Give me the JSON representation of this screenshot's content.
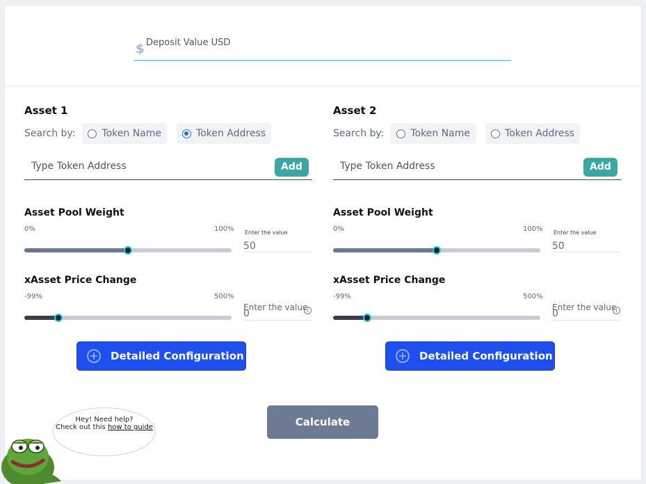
{
  "deposit": {
    "currency_symbol": "$",
    "placeholder": "Deposit Value USD"
  },
  "assets": [
    {
      "title": "Asset 1",
      "search_by_label": "Search by:",
      "options": [
        {
          "label": "Token Name",
          "checked": false
        },
        {
          "label": "Token Address",
          "checked": true
        }
      ],
      "token_placeholder": "Type Token Address",
      "add_label": "Add",
      "pool_weight": {
        "title": "Asset Pool Weight",
        "min_label": "0%",
        "max_label": "100%",
        "value_hint": "Enter the value",
        "value": "50",
        "slider_fraction": 0.5
      },
      "price_change": {
        "title": "xAsset Price Change",
        "min_label": "-99%",
        "max_label": "500%",
        "value_hint": "Enter the value",
        "value": "0",
        "slider_fraction": 0.165
      },
      "detail_label": "Detailed Configuration"
    },
    {
      "title": "Asset 2",
      "search_by_label": "Search by:",
      "options": [
        {
          "label": "Token Name",
          "checked": false
        },
        {
          "label": "Token Address",
          "checked": false
        }
      ],
      "token_placeholder": "Type Token Address",
      "add_label": "Add",
      "pool_weight": {
        "title": "Asset Pool Weight",
        "min_label": "0%",
        "max_label": "100%",
        "value_hint": "Enter the value",
        "value": "50",
        "slider_fraction": 0.5
      },
      "price_change": {
        "title": "xAsset Price Change",
        "min_label": "-99%",
        "max_label": "500%",
        "value_hint": "Enter the value",
        "value": "0",
        "slider_fraction": 0.165
      },
      "detail_label": "Detailed Configuration"
    }
  ],
  "calculate_label": "Calculate",
  "help": {
    "line1": "Hey! Need help?",
    "line2_prefix": "Check out this ",
    "link_text": "how to guide"
  },
  "colors": {
    "accent_blue": "#1e50f0",
    "teal": "#3aa6a6",
    "slider_thumb_ring": "#2ecbe0",
    "calculate_bg": "#6c7a92"
  },
  "icons": {
    "currency": "dollar-icon",
    "info": "info-icon",
    "detail": "plus-circle-icon",
    "mascot": "frog-mascot"
  }
}
